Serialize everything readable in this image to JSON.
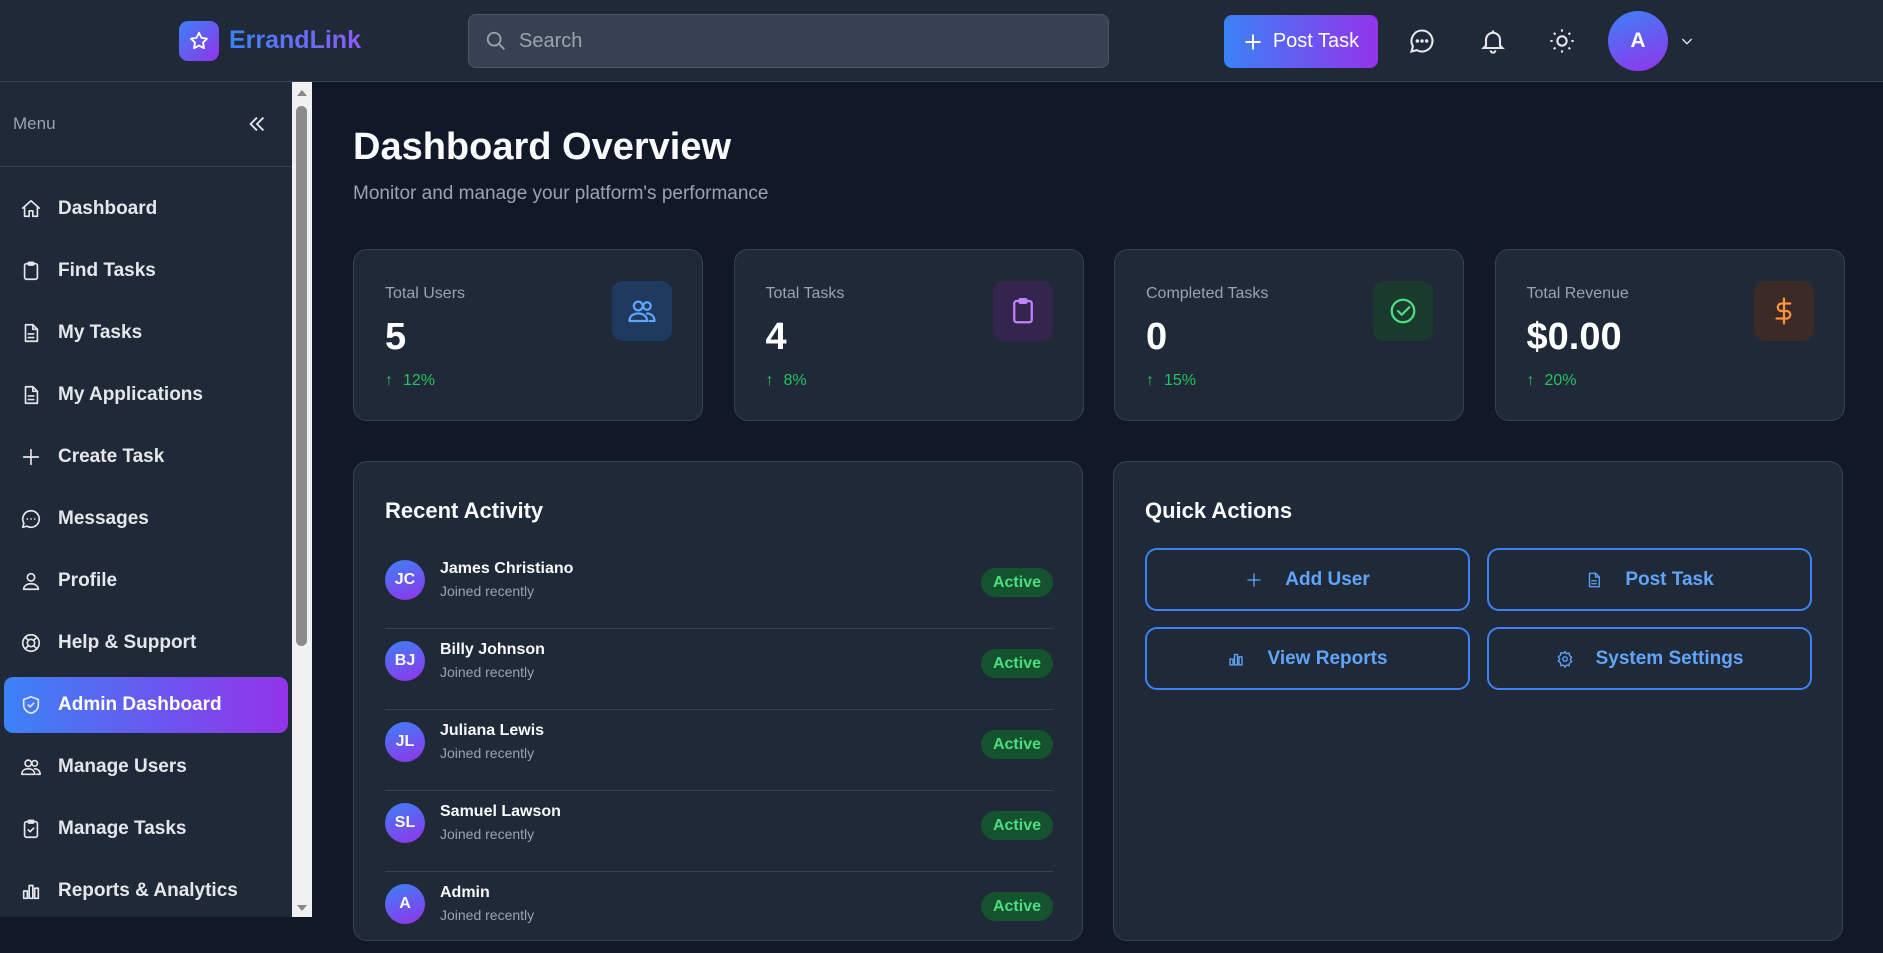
{
  "header": {
    "app_name": "ErrandLink",
    "search_placeholder": "Search",
    "post_task_label": "Post Task",
    "avatar_initial": "A"
  },
  "sidebar": {
    "menu_label": "Menu",
    "items": [
      {
        "label": "Dashboard",
        "icon": "home"
      },
      {
        "label": "Find Tasks",
        "icon": "clipboard"
      },
      {
        "label": "My Tasks",
        "icon": "document"
      },
      {
        "label": "My Applications",
        "icon": "document"
      },
      {
        "label": "Create Task",
        "icon": "plus"
      },
      {
        "label": "Messages",
        "icon": "chat"
      },
      {
        "label": "Profile",
        "icon": "user"
      },
      {
        "label": "Help & Support",
        "icon": "lifebuoy"
      },
      {
        "label": "Admin Dashboard",
        "icon": "shield",
        "active": true
      },
      {
        "label": "Manage Users",
        "icon": "users"
      },
      {
        "label": "Manage Tasks",
        "icon": "clipboard-check"
      },
      {
        "label": "Reports & Analytics",
        "icon": "bar-chart"
      }
    ]
  },
  "page": {
    "title": "Dashboard Overview",
    "subtitle": "Monitor and manage your platform's performance"
  },
  "stats": [
    {
      "label": "Total Users",
      "value": "5",
      "change": "12%",
      "icon": "users",
      "color": "#60a5fa",
      "bg": "#1e3a5f"
    },
    {
      "label": "Total Tasks",
      "value": "4",
      "change": "8%",
      "icon": "clipboard",
      "color": "#c084fc",
      "bg": "#33254d"
    },
    {
      "label": "Completed Tasks",
      "value": "0",
      "change": "15%",
      "icon": "check-circle",
      "color": "#4ade80",
      "bg": "#1a3a2e"
    },
    {
      "label": "Total Revenue",
      "value": "$0.00",
      "change": "20%",
      "icon": "dollar",
      "color": "#fb923c",
      "bg": "#3b2a25"
    }
  ],
  "recent_activity": {
    "title": "Recent Activity",
    "items": [
      {
        "initials": "JC",
        "name": "James Christiano",
        "sub": "Joined recently",
        "status": "Active"
      },
      {
        "initials": "BJ",
        "name": "Billy Johnson",
        "sub": "Joined recently",
        "status": "Active"
      },
      {
        "initials": "JL",
        "name": "Juliana Lewis",
        "sub": "Joined recently",
        "status": "Active"
      },
      {
        "initials": "SL",
        "name": "Samuel Lawson",
        "sub": "Joined recently",
        "status": "Active"
      },
      {
        "initials": "A",
        "name": "Admin",
        "sub": "Joined recently",
        "status": "Active"
      }
    ]
  },
  "quick_actions": {
    "title": "Quick Actions",
    "items": [
      {
        "label": "Add User",
        "icon": "plus"
      },
      {
        "label": "Post Task",
        "icon": "document"
      },
      {
        "label": "View Reports",
        "icon": "bar-chart"
      },
      {
        "label": "System Settings",
        "icon": "gear"
      }
    ]
  }
}
